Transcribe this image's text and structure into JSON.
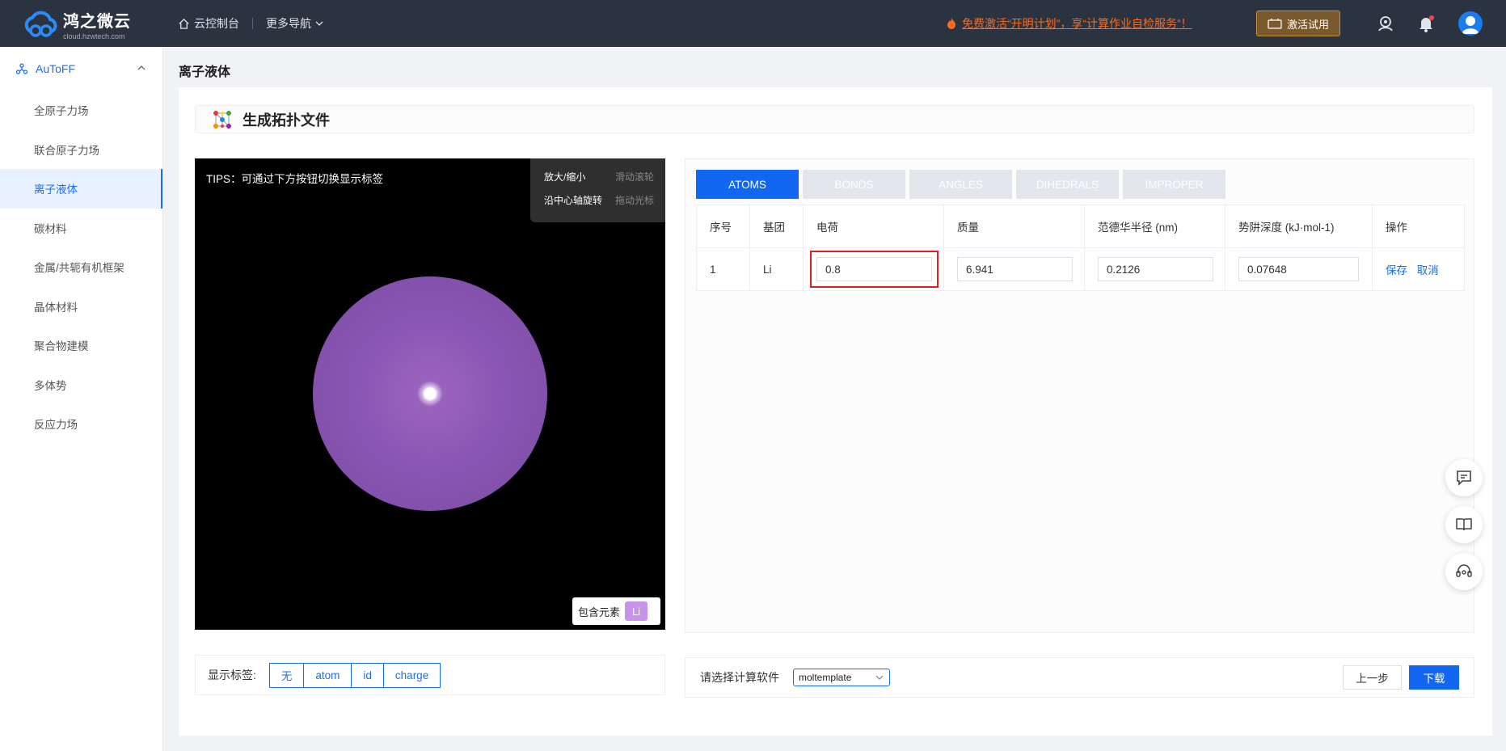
{
  "brand": {
    "name": "鸿之微云",
    "domain": "cloud.hzwtech.com"
  },
  "topnav": {
    "console": "云控制台",
    "more": "更多导航"
  },
  "promo": "免费激活“开明计划”，享“计算作业自检服务”！",
  "trial_button": "激活试用",
  "sidebar": {
    "group": "AuToFF",
    "items": [
      "全原子力场",
      "联合原子力场",
      "离子液体",
      "碳材料",
      "金属/共轭有机框架",
      "晶体材料",
      "聚合物建模",
      "多体势",
      "反应力场"
    ],
    "active_index": 2
  },
  "page_title": "离子液体",
  "section_title": "生成拓扑文件",
  "viewer": {
    "tips": "TIPS：可通过下方按钮切换显示标签",
    "hints": [
      {
        "action": "放大/缩小",
        "how": "滑动滚轮"
      },
      {
        "action": "沿中心轴旋转",
        "how": "拖动光标"
      }
    ],
    "elements_label": "包含元素",
    "element": "Li"
  },
  "tabs": [
    "ATOMS",
    "BONDS",
    "ANGLES",
    "DIHEDRALS",
    "IMPROPER"
  ],
  "table": {
    "headers": [
      "序号",
      "基团",
      "电荷",
      "质量",
      "范德华半径 (nm)",
      "势阱深度 (kJ·mol-1)",
      "操作"
    ],
    "row": {
      "index": "1",
      "group": "Li",
      "charge": "0.8",
      "mass": "6.941",
      "vdw_radius": "0.2126",
      "well_depth": "0.07648"
    },
    "actions": {
      "save": "保存",
      "cancel": "取消"
    }
  },
  "label_bar": {
    "label": "显示标签:",
    "options": [
      "无",
      "atom",
      "id",
      "charge"
    ]
  },
  "software_bar": {
    "label": "请选择计算软件",
    "selected": "moltemplate",
    "prev": "上一步",
    "download": "下载"
  },
  "colors": {
    "primary": "#1167f2",
    "topbar": "#2b3240",
    "promo": "#ff6a1a",
    "highlight": "#e02020",
    "atom": "#8a56b3"
  }
}
